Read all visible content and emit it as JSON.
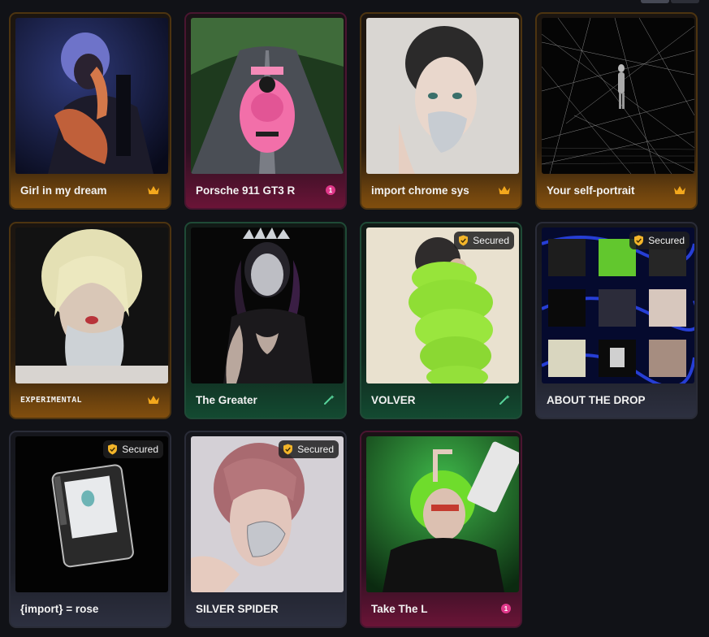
{
  "colors": {
    "gold": "#f3a81d",
    "pink": "#e0388a",
    "green": "#57d39a",
    "background": "#111217"
  },
  "cards": [
    {
      "title": "Girl in my dream",
      "badge": "crown",
      "theme": "gold",
      "image": "portrait-blue-hair"
    },
    {
      "title": "Porsche 911 GT3 R",
      "badge": "count",
      "badge_value": "1",
      "theme": "pink",
      "image": "pink-sports-car"
    },
    {
      "title": "import chrome sys",
      "badge": "crown",
      "theme": "gold",
      "image": "portrait-chrome-face"
    },
    {
      "title": "Your self-portrait",
      "badge": "crown",
      "theme": "gold",
      "image": "wireframe-figure"
    },
    {
      "title": "EXPERIMENTAL",
      "badge": "crown",
      "theme": "gold",
      "image": "portrait-blonde-chrome"
    },
    {
      "title": "The Greater",
      "badge": "wand",
      "theme": "green",
      "image": "portrait-crown"
    },
    {
      "title": "VOLVER",
      "badge": "wand",
      "theme": "green",
      "secured": "Secured",
      "image": "green-puffer-jacket"
    },
    {
      "title": "ABOUT THE DROP",
      "badge": "none",
      "theme": "slate",
      "secured": "Secured",
      "image": "drop-collage"
    },
    {
      "title": "{import} = rose",
      "badge": "none",
      "theme": "slate",
      "secured": "Secured",
      "image": "card-object"
    },
    {
      "title": "SILVER SPIDER",
      "badge": "none",
      "theme": "slate",
      "secured": "Secured",
      "image": "portrait-silver-spider"
    },
    {
      "title": "Take The L",
      "badge": "count",
      "badge_value": "1",
      "theme": "pink",
      "image": "green-hair-gun"
    }
  ]
}
